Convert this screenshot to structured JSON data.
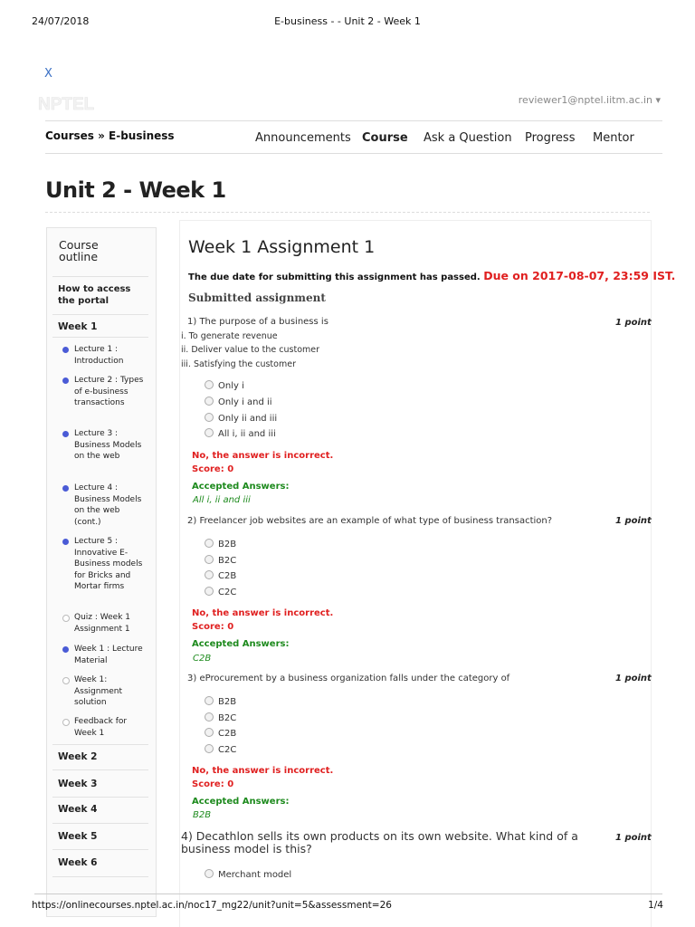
{
  "print_header": {
    "date": "24/07/2018",
    "title": "E-business - - Unit 2 - Week 1"
  },
  "print_footer": {
    "url": "https://onlinecourses.nptel.ac.in/noc17_mg22/unit?unit=5&assessment=26",
    "page": "1/4"
  },
  "header": {
    "close_label": "X",
    "logo_text": "NPTEL",
    "user": "reviewer1@nptel.iitm.ac.in ▾",
    "breadcrumb": "Courses » E-business",
    "nav": [
      "Announcements",
      "Course",
      "Ask a Question",
      "Progress",
      "Mentor"
    ]
  },
  "page_title": "Unit 2 - Week 1",
  "sidebar": {
    "title": "Course outline",
    "how_to": "How to access the portal",
    "week1": "Week 1",
    "lessons": [
      "Lecture 1 : Introduction",
      "Lecture 2 : Types of e-business transactions",
      "Lecture 3 : Business Models on the web",
      "Lecture 4 : Business Models on the web (cont.)",
      "Lecture 5 : Innovative E-Business models for Bricks and Mortar firms",
      "Quiz : Week 1 Assignment 1",
      "Week 1 : Lecture Material",
      "Week 1: Assignment solution",
      "Feedback for Week 1"
    ],
    "lesson_states": [
      "done",
      "done",
      "done",
      "done",
      "done",
      "todo",
      "done",
      "todo",
      "todo"
    ],
    "weeks": [
      "Week 2",
      "Week 3",
      "Week 4",
      "Week 5",
      "Week 6"
    ]
  },
  "assignment": {
    "title": "Week 1 Assignment 1",
    "due_text": "The due date for submitting this assignment has passed.",
    "due_date": "Due on 2017-08-07, 23:59 IST.",
    "submitted": "Submitted assignment",
    "wrong": "No, the answer is incorrect.",
    "score": "Score: 0",
    "accepted_label": "Accepted Answers:",
    "questions": [
      {
        "text": "1) The purpose of a business is",
        "points": "1 point",
        "statements": [
          "i. To generate revenue",
          "ii. Deliver value to the customer",
          "iii. Satisfying the customer"
        ],
        "options": [
          "Only i",
          "Only i and ii",
          "Only ii and iii",
          "All i, ii and iii"
        ],
        "accepted": "All i, ii and iii"
      },
      {
        "text": "2) Freelancer job websites are an example of what type of business transaction?",
        "points": "1 point",
        "options": [
          "B2B",
          "B2C",
          "C2B",
          "C2C"
        ],
        "accepted": "C2B"
      },
      {
        "text": "3) eProcurement by a business organization falls under the category of",
        "points": "1 point",
        "options": [
          "B2B",
          "B2C",
          "C2B",
          "C2C"
        ],
        "accepted": "B2B"
      },
      {
        "text": "4) Decathlon sells its own products on its own website. What kind of a business model is this?",
        "points": "1 point",
        "options": [
          "Merchant model"
        ]
      }
    ]
  }
}
